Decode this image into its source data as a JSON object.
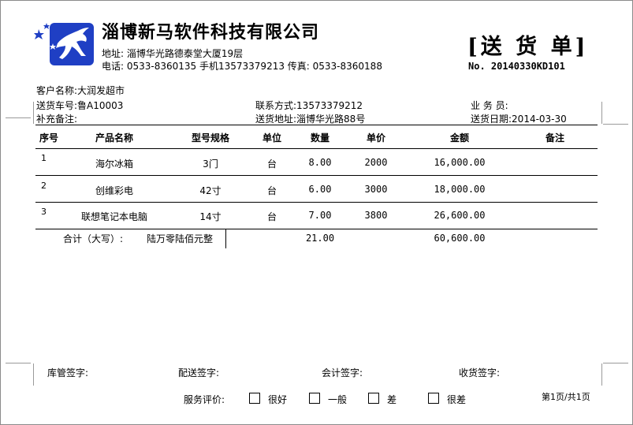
{
  "company": {
    "name": "淄博新马软件科技有限公司",
    "address": "地址:  淄博华光路德泰堂大厦19层",
    "contact": "电话:  0533-8360135 手机13573379213 传真:  0533-8360188"
  },
  "document": {
    "title": "[送 货 单]",
    "number": "No. 20140330KD101"
  },
  "info": {
    "customer": "客户名称:大润发超市",
    "vehicle": "送货车号:鲁A10003",
    "contact": "联系方式:13573379212",
    "clerk": "业 务 员:",
    "note": "补充备注:",
    "address": "送货地址:淄博华光路88号",
    "date": "送货日期:2014-03-30"
  },
  "table": {
    "headers": {
      "no": "序号",
      "name": "产品名称",
      "spec": "型号规格",
      "unit": "单位",
      "qty": "数量",
      "price": "单价",
      "amount": "金额",
      "remark": "备注"
    },
    "rows": [
      {
        "no": "1",
        "name": "海尔冰箱",
        "spec": "3门",
        "unit": "台",
        "qty": "8.00",
        "price": "2000",
        "amount": "16,000.00"
      },
      {
        "no": "2",
        "name": "创维彩电",
        "spec": "42寸",
        "unit": "台",
        "qty": "6.00",
        "price": "3000",
        "amount": "18,000.00"
      },
      {
        "no": "3",
        "name": "联想笔记本电脑",
        "spec": "14寸",
        "unit": "台",
        "qty": "7.00",
        "price": "3800",
        "amount": "26,600.00"
      }
    ],
    "total": {
      "label": "合计（大写）:",
      "words": "陆万零陆佰元整",
      "qty": "21.00",
      "amount": "60,600.00"
    }
  },
  "signatures": {
    "warehouse": "库管签字:",
    "delivery": "配送签字:",
    "accounting": "会计签字:",
    "receiver": "收货签字:"
  },
  "evaluation": {
    "label": "服务评价:",
    "options": [
      "很好",
      "一般",
      "差",
      "很差"
    ]
  },
  "pager": "第1页/共1页",
  "colors": {
    "logo_blue": "#1f3fc4",
    "border": "#8a8a8a"
  }
}
